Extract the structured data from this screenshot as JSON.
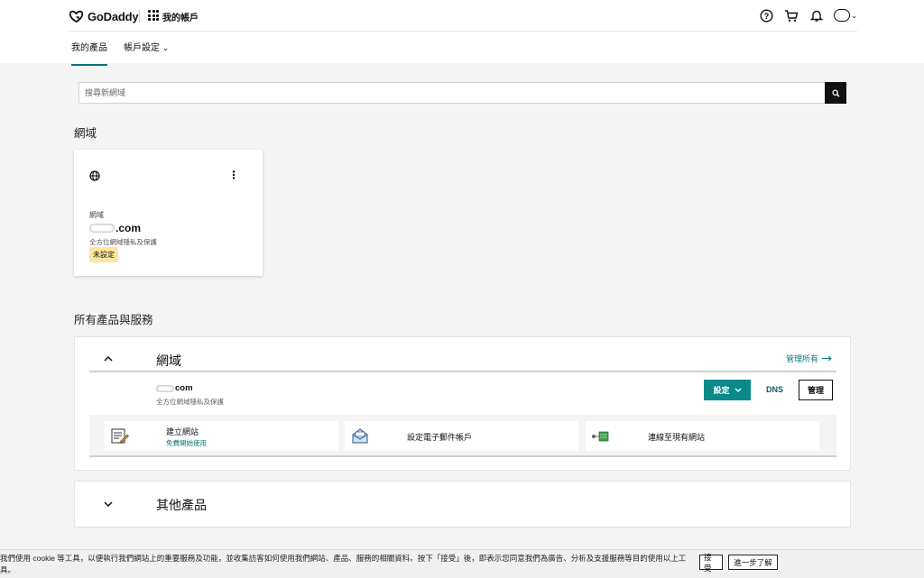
{
  "header": {
    "logo_text": "GoDaddy",
    "my_account": "我的帳戶",
    "icons": [
      "help-icon",
      "cart-icon",
      "bell-icon",
      "avatar"
    ]
  },
  "subnav": {
    "items": [
      {
        "label": "我的產品",
        "active": true
      },
      {
        "label": "帳戶設定",
        "active": false
      }
    ]
  },
  "search": {
    "placeholder": "搜尋新網域"
  },
  "domains_section": {
    "title": "網域",
    "card": {
      "label": "網域",
      "domain_suffix": ".com",
      "subtitle": "全方位網域隱私及保護",
      "badge": "未設定"
    }
  },
  "all_products": {
    "title": "所有產品與服務",
    "domain_group": {
      "title": "網域",
      "manage_all": "管理所有",
      "row": {
        "domain_suffix": "com",
        "subtitle": "全方位網域隱私及保護",
        "setup_label": "設定",
        "dns_label": "DNS",
        "manage_label": "管理"
      },
      "actions": [
        {
          "title": "建立網站",
          "link": "免費開始使用",
          "icon": "website-builder-icon"
        },
        {
          "title": "設定電子郵件帳戶",
          "icon": "email-icon"
        },
        {
          "title": "連線至現有網站",
          "icon": "connect-site-icon"
        }
      ]
    },
    "other_group": {
      "title": "其他產品"
    }
  },
  "cookie_bar": {
    "text": "我們使用 cookie 等工具，以便執行我們網站上的重要服務及功能，並收集訪客如何使用我們網站、產品、服務的相關資料。按下「接受」後，即表示您同意我們為廣告、分析及支援服務等目的使用以上工具。",
    "accept_label": "接受",
    "learn_more_label": "進一步了解"
  },
  "colors": {
    "accent": "#09757a",
    "setup_button": "#0a8a8a",
    "badge": "#fde59b"
  }
}
